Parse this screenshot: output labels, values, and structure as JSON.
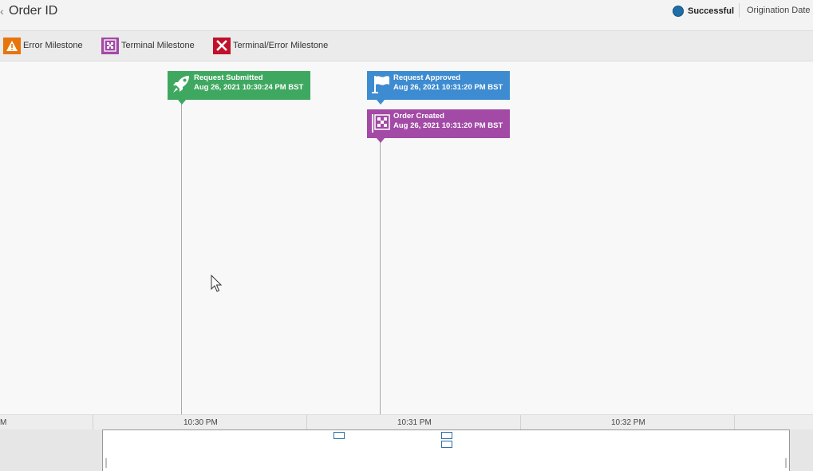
{
  "header": {
    "back_icon": "chevron-left-icon",
    "title": "Order ID",
    "status_label": "Successful",
    "status_color": "#1e6fa8",
    "origination_label": "Origination Date"
  },
  "legend": {
    "items": [
      {
        "label": "Error Milestone",
        "icon": "warning-icon",
        "color": "#e8740c"
      },
      {
        "label": "Terminal Milestone",
        "icon": "checkered-flag-icon",
        "color": "#a24aa6"
      },
      {
        "label": "Terminal/Error Milestone",
        "icon": "x-icon",
        "color": "#c0112a"
      }
    ]
  },
  "events": [
    {
      "title": "Request Submitted",
      "timestamp": "Aug 26, 2021 10:30:24 PM BST",
      "icon": "rocket-icon",
      "color": "#3fa860"
    },
    {
      "title": "Request Approved",
      "timestamp": "Aug 26, 2021 10:31:20 PM BST",
      "icon": "flag-icon",
      "color": "#3d8bd0"
    },
    {
      "title": "Order Created",
      "timestamp": "Aug 26, 2021 10:31:20 PM BST",
      "icon": "checkered-flag-icon",
      "color": "#a24aa6"
    }
  ],
  "axis": {
    "ticks": [
      "M",
      "10:30 PM",
      "10:31 PM",
      "10:32 PM"
    ]
  }
}
